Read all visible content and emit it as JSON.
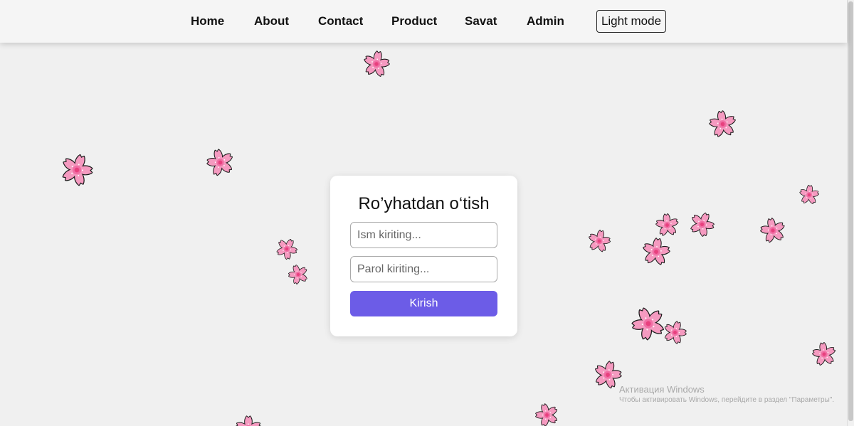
{
  "nav": {
    "items": [
      {
        "label": "Home"
      },
      {
        "label": "About"
      },
      {
        "label": "Contact"
      },
      {
        "label": "Product"
      },
      {
        "label": "Savat"
      },
      {
        "label": "Admin"
      }
    ],
    "mode_button": "Light mode"
  },
  "login": {
    "title": "Ro’yhatdan o‘tish",
    "name_placeholder": "Ism kiriting...",
    "password_placeholder": "Parol kiriting...",
    "submit_label": "Kirish"
  },
  "watermark": {
    "title": "Активация Windows",
    "subtitle": "Чтобы активировать Windows, перейдите в раздел \"Параметры\"."
  },
  "colors": {
    "background": "#f0f0f0",
    "accent": "#6c5ce7",
    "petal": "#f59ac0",
    "petal_outline": "#1a1a1a",
    "flower_center": "#e8407e"
  },
  "decorations": {
    "icon": "sakura-flower-icon"
  }
}
